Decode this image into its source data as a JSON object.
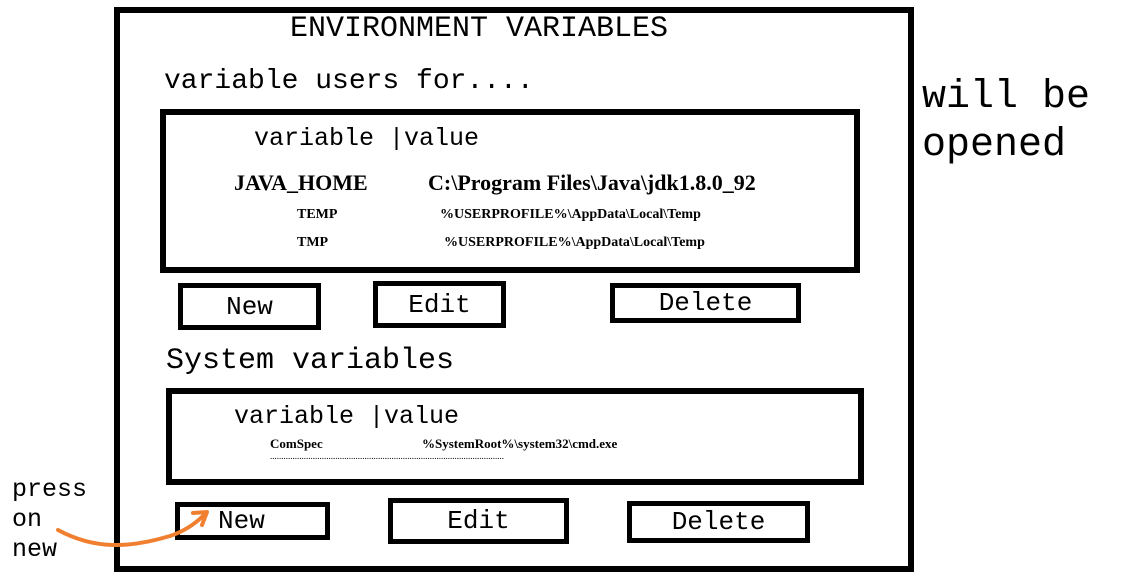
{
  "dialog": {
    "title": "ENVIRONMENT VARIABLES",
    "user_section_label": "variable users for....",
    "system_section_label": "System variables"
  },
  "user_vars": {
    "header": "variable |value",
    "rows": [
      {
        "name": "JAVA_HOME",
        "value": "C:\\Program Files\\Java\\jdk1.8.0_92"
      },
      {
        "name": "TEMP",
        "value": "%USERPROFILE%\\AppData\\Local\\Temp"
      },
      {
        "name": "TMP",
        "value": "%USERPROFILE%\\AppData\\Local\\Temp"
      }
    ],
    "buttons": {
      "new": "New",
      "edit": "Edit",
      "delete": "Delete"
    }
  },
  "system_vars": {
    "header": "variable |value",
    "rows": [
      {
        "name": "ComSpec",
        "value": "%SystemRoot%\\system32\\cmd.exe"
      }
    ],
    "ellipsis_line": "........................................................................................................",
    "buttons": {
      "new": "New",
      "edit": "Edit",
      "delete": "Delete"
    }
  },
  "annotations": {
    "will_be_opened_line1": "will be",
    "will_be_opened_line2": "opened",
    "press_line1": "press",
    "press_line2": "on",
    "press_line3": "new",
    "arrow_color": "#f08030"
  }
}
